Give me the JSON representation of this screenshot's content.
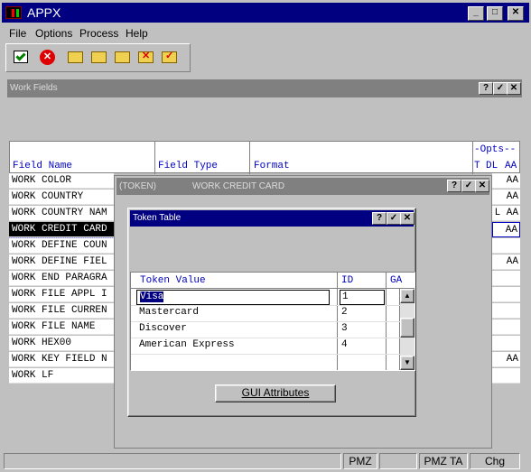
{
  "app": {
    "title": "APPX"
  },
  "menu": [
    "File",
    "Options",
    "Process",
    "Help"
  ],
  "toolbar_icons": [
    "check-edit-icon",
    "cancel-icon",
    "folder-new-icon",
    "folder-edit-icon",
    "folder-search-icon",
    "folder-delete-icon",
    "folder-check-icon"
  ],
  "workfields": {
    "title": "Work Fields",
    "columns": {
      "field_name": "Field Name",
      "field_type": "Field Type",
      "format": "Format",
      "opts": "-Opts--",
      "t": "T",
      "dl": "DL",
      "aa": "AA"
    },
    "rows": [
      {
        "name": "WORK COLOR",
        "opts": "AA"
      },
      {
        "name": "WORK COUNTRY",
        "opts": "AA"
      },
      {
        "name": "WORK COUNTRY NAM",
        "opts": "L AA"
      },
      {
        "name": "WORK CREDIT CARD",
        "opts": "AA"
      },
      {
        "name": "WORK DEFINE COUN",
        "opts": ""
      },
      {
        "name": "WORK DEFINE FIEL",
        "opts": "AA"
      },
      {
        "name": "WORK END PARAGRA",
        "opts": ""
      },
      {
        "name": "WORK FILE APPL I",
        "opts": ""
      },
      {
        "name": "WORK FILE CURREN",
        "opts": ""
      },
      {
        "name": "WORK FILE NAME",
        "opts": ""
      },
      {
        "name": "WORK HEX00",
        "opts": ""
      },
      {
        "name": "WORK KEY FIELD N",
        "opts": "AA"
      },
      {
        "name": "WORK LF",
        "opts": ""
      }
    ]
  },
  "token_window": {
    "title_prefix": "(TOKEN)",
    "title": "WORK CREDIT CARD"
  },
  "token_table": {
    "title": "Token Table",
    "columns": {
      "value": "Token Value",
      "id": "ID",
      "ga": "GA"
    },
    "rows": [
      {
        "value": "Visa",
        "id": "1"
      },
      {
        "value": "Mastercard",
        "id": "2"
      },
      {
        "value": "Discover",
        "id": "3"
      },
      {
        "value": "American Express",
        "id": "4"
      }
    ],
    "gui_button": "GUI Attributes"
  },
  "status": {
    "s1": "PMZ",
    "s2": "PMZ TA",
    "s3": "Chg"
  }
}
